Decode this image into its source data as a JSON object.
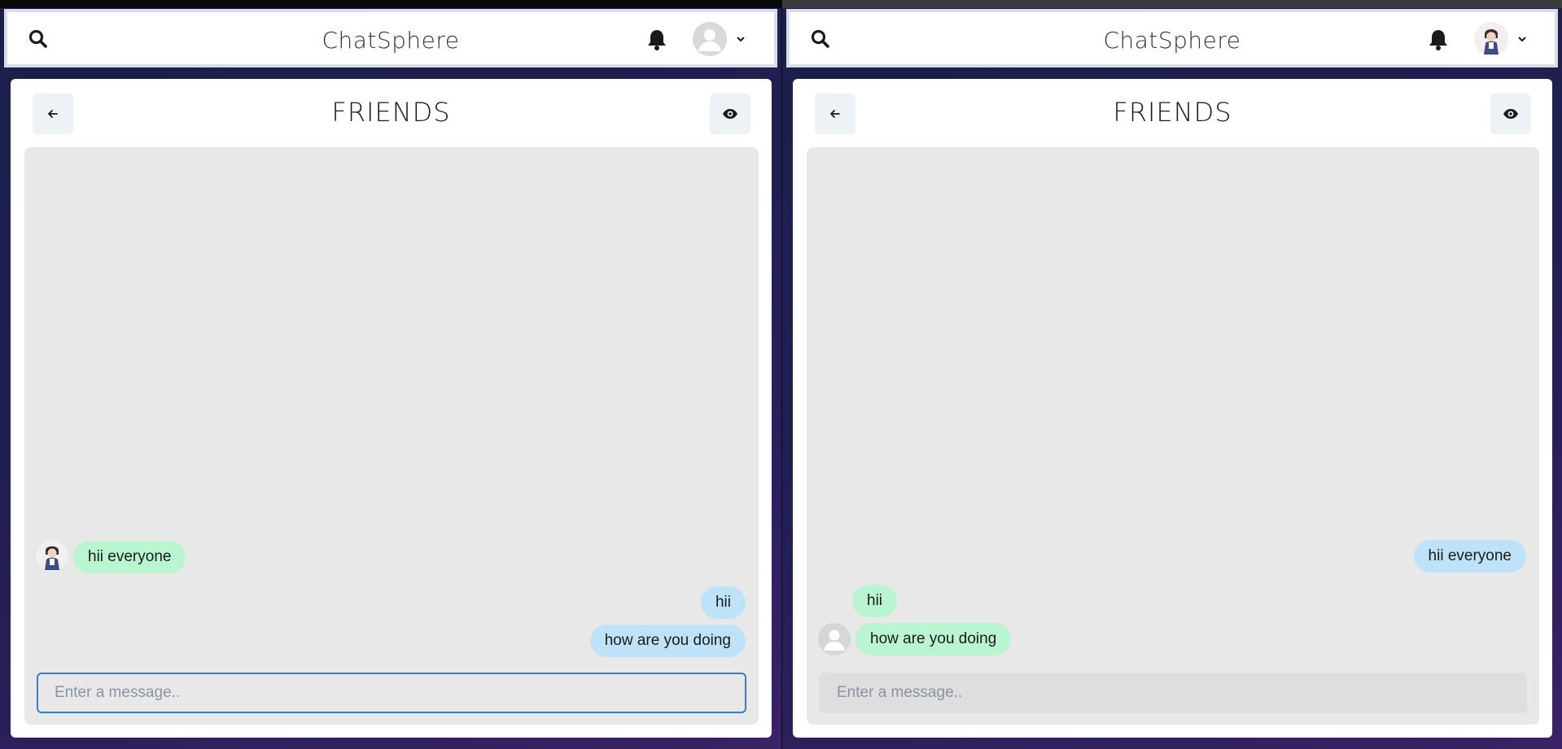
{
  "colors": {
    "background_top": "#1b1f4a",
    "background_bottom": "#3a2266",
    "card": "#ffffff",
    "chat_area": "#e8e8e8",
    "bubble_green": "#b9f5d0",
    "bubble_blue": "#bee3f8",
    "input_focus_border": "#3182ce"
  },
  "icons": {
    "search": "search-icon",
    "notifications": "bell-icon",
    "back": "arrow-left-icon",
    "view": "eye-icon",
    "dropdown": "chevron-down-icon"
  },
  "left_window": {
    "navbar": {
      "brand": "ChatSphere",
      "profile_avatar": "default-avatar"
    },
    "chat": {
      "title": "FRIENDS",
      "messages": [
        {
          "text": "hii everyone",
          "side": "left",
          "sender_avatar": "anime-character-avatar"
        },
        {
          "text": "hii",
          "side": "right"
        },
        {
          "text": "how are you doing",
          "side": "right"
        }
      ],
      "input": {
        "placeholder": "Enter a message..",
        "value": "",
        "focused": true
      }
    }
  },
  "right_window": {
    "navbar": {
      "brand": "ChatSphere",
      "profile_avatar": "anime-character-avatar"
    },
    "chat": {
      "title": "FRIENDS",
      "messages": [
        {
          "text": "hii everyone",
          "side": "right"
        },
        {
          "text": "hii",
          "side": "left"
        },
        {
          "text": "how are you doing",
          "side": "left",
          "sender_avatar": "default-avatar"
        }
      ],
      "input": {
        "placeholder": "Enter a message..",
        "value": "",
        "focused": false
      }
    }
  }
}
